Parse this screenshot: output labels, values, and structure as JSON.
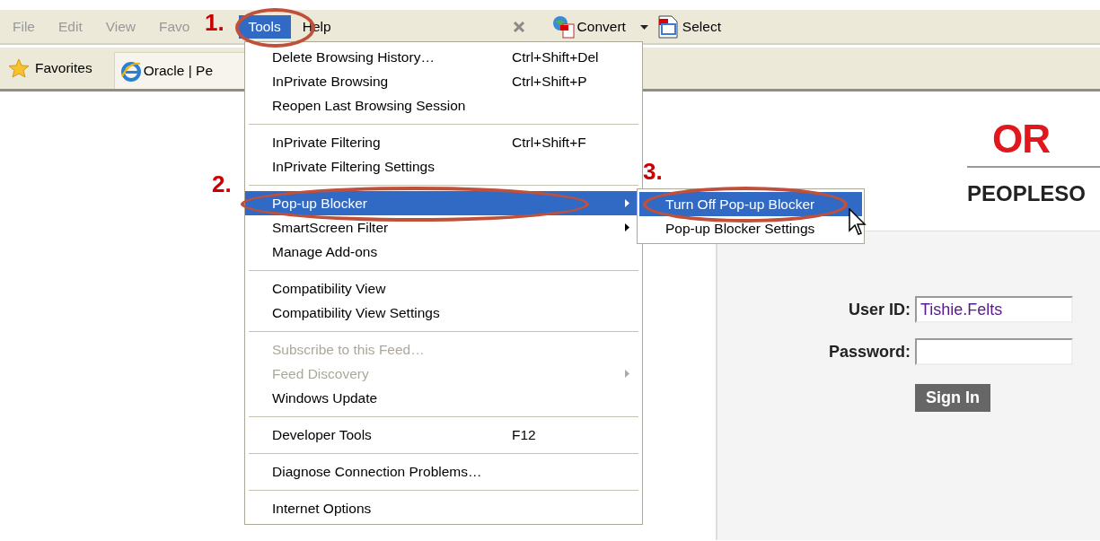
{
  "menu_bar": [
    {
      "label": "File",
      "selected": false
    },
    {
      "label": "Edit",
      "selected": false
    },
    {
      "label": "View",
      "selected": false
    },
    {
      "label": "Favo",
      "selected": false
    },
    {
      "label": "Tools",
      "selected": true
    },
    {
      "label": "Help",
      "selected": false
    }
  ],
  "command_bar": {
    "convert": "Convert",
    "select": "Select"
  },
  "favorites_bar": {
    "favorites": "Favorites",
    "tab": "Oracle | Pe"
  },
  "tools_menu": [
    [
      {
        "label": "Delete Browsing History…",
        "shortcut": "Ctrl+Shift+Del",
        "submenu": false,
        "disabled": false,
        "selected": false
      },
      {
        "label": "InPrivate Browsing",
        "shortcut": "Ctrl+Shift+P",
        "submenu": false,
        "disabled": false,
        "selected": false
      },
      {
        "label": "Reopen Last Browsing Session",
        "submenu": false,
        "disabled": false,
        "selected": false
      }
    ],
    [
      {
        "label": "InPrivate Filtering",
        "shortcut": "Ctrl+Shift+F",
        "submenu": false,
        "disabled": false,
        "selected": false
      },
      {
        "label": "InPrivate Filtering Settings",
        "submenu": false,
        "disabled": false,
        "selected": false
      }
    ],
    [
      {
        "label": "Pop-up Blocker",
        "submenu": true,
        "disabled": false,
        "selected": true
      },
      {
        "label": "SmartScreen Filter",
        "submenu": true,
        "disabled": false,
        "selected": false
      },
      {
        "label": "Manage Add-ons",
        "submenu": false,
        "disabled": false,
        "selected": false
      }
    ],
    [
      {
        "label": "Compatibility View",
        "submenu": false,
        "disabled": false,
        "selected": false
      },
      {
        "label": "Compatibility View Settings",
        "submenu": false,
        "disabled": false,
        "selected": false
      }
    ],
    [
      {
        "label": "Subscribe to this Feed…",
        "submenu": false,
        "disabled": true,
        "selected": false
      },
      {
        "label": "Feed Discovery",
        "submenu": true,
        "disabled": true,
        "selected": false
      },
      {
        "label": "Windows Update",
        "submenu": false,
        "disabled": false,
        "selected": false
      }
    ],
    [
      {
        "label": "Developer Tools",
        "shortcut": "F12",
        "submenu": false,
        "disabled": false,
        "selected": false
      }
    ],
    [
      {
        "label": "Diagnose Connection Problems…",
        "submenu": false,
        "disabled": false,
        "selected": false
      }
    ],
    [
      {
        "label": "Internet Options",
        "submenu": false,
        "disabled": false,
        "selected": false
      }
    ]
  ],
  "popup_submenu": [
    {
      "label": "Turn Off Pop-up Blocker",
      "selected": true
    },
    {
      "label": "Pop-up Blocker Settings",
      "selected": false
    }
  ],
  "annotations": [
    "1.",
    "2.",
    "3."
  ],
  "page": {
    "logo": "OR",
    "product": "PEOPLESO",
    "user_id_label": "User ID:",
    "user_id": "Tishie.Felts",
    "password_label": "Password:",
    "sign_in": "Sign In"
  }
}
